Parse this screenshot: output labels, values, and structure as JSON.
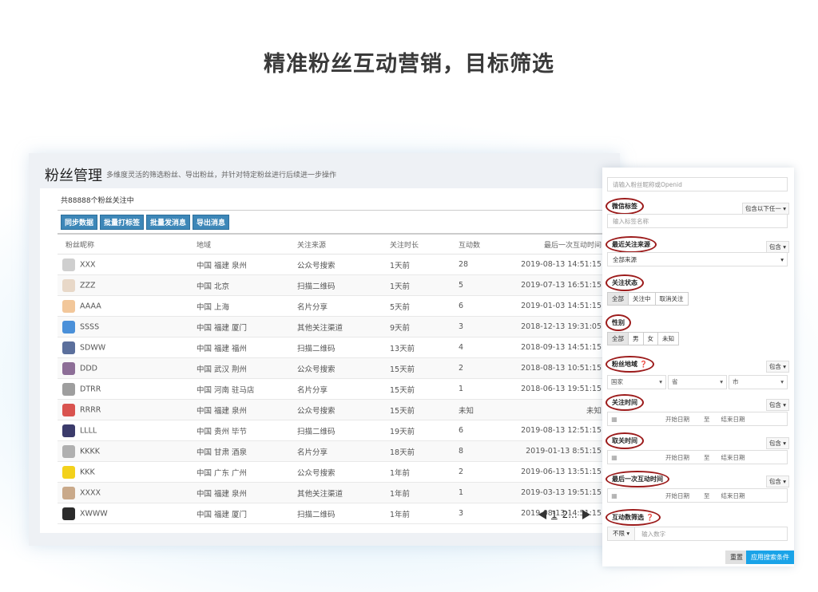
{
  "headline": "精准粉丝互动营销，目标筛选",
  "page": {
    "title": "粉丝管理",
    "subtitle": "多维度灵活的筛选粉丝、导出粉丝，并针对特定粉丝进行后续进一步操作",
    "fan_count": "共88888个粉丝关注中"
  },
  "actions": [
    "同步数据",
    "批量打标签",
    "批量发消息",
    "导出消息"
  ],
  "table": {
    "headers": [
      "粉丝昵称",
      "地域",
      "关注来源",
      "关注时长",
      "互动数",
      "最后一次互动时间"
    ],
    "rows": [
      {
        "name": "XXX",
        "region": "中国 福建 泉州",
        "source": "公众号搜索",
        "duration": "1天前",
        "count": "28",
        "last": "2019-08-13  14:51:15",
        "avatar_color": "#cfcfcf"
      },
      {
        "name": "ZZZ",
        "region": "中国 北京",
        "source": "扫描二维码",
        "duration": "1天前",
        "count": "5",
        "last": "2019-07-13  16:51:15",
        "avatar_color": "#e8d8c8"
      },
      {
        "name": "AAAA",
        "region": "中国 上海",
        "source": "名片分享",
        "duration": "5天前",
        "count": "6",
        "last": "2019-01-03  14:51:15",
        "avatar_color": "#f2c79a"
      },
      {
        "name": "SSSS",
        "region": "中国 福建 厦门",
        "source": "其他关注渠道",
        "duration": "9天前",
        "count": "3",
        "last": "2018-12-13  19:31:05",
        "avatar_color": "#4a90d9"
      },
      {
        "name": "SDWW",
        "region": "中国 福建 福州",
        "source": "扫描二维码",
        "duration": "13天前",
        "count": "4",
        "last": "2018-09-13  14:51:15",
        "avatar_color": "#5b6f9c"
      },
      {
        "name": "DDD",
        "region": "中国 武汉 荆州",
        "source": "公众号搜索",
        "duration": "15天前",
        "count": "2",
        "last": "2018-08-13  10:51:15",
        "avatar_color": "#8d6e97"
      },
      {
        "name": "DTRR",
        "region": "中国 河南 驻马店",
        "source": "名片分享",
        "duration": "15天前",
        "count": "1",
        "last": "2018-06-13  19:51:15",
        "avatar_color": "#9e9e9e"
      },
      {
        "name": "RRRR",
        "region": "中国 福建 泉州",
        "source": "公众号搜索",
        "duration": "15天前",
        "count": "未知",
        "last": "未知",
        "avatar_color": "#d9534f"
      },
      {
        "name": "LLLL",
        "region": "中国 贵州 毕节",
        "source": "扫描二维码",
        "duration": "19天前",
        "count": "6",
        "last": "2019-08-13  12:51:15",
        "avatar_color": "#3b3b6b"
      },
      {
        "name": "KKKK",
        "region": "中国 甘肃 酒泉",
        "source": "名片分享",
        "duration": "18天前",
        "count": "8",
        "last": "2019-01-13  8:51:15",
        "avatar_color": "#b0b0b0"
      },
      {
        "name": "KKK",
        "region": "中国 广东 广州",
        "source": "公众号搜索",
        "duration": "1年前",
        "count": "2",
        "last": "2019-06-13  13:51:15",
        "avatar_color": "#f3d11b"
      },
      {
        "name": "XXXX",
        "region": "中国 福建 泉州",
        "source": "其他关注渠道",
        "duration": "1年前",
        "count": "1",
        "last": "2019-03-13  19:51:15",
        "avatar_color": "#c9a98a"
      },
      {
        "name": "XWWW",
        "region": "中国 福建 厦门",
        "source": "扫描二维码",
        "duration": "1年前",
        "count": "3",
        "last": "2019-08-13  14:51:15",
        "avatar_color": "#2b2b2b"
      }
    ]
  },
  "pager": {
    "page1": "1",
    "page2": "2...",
    "current_page": 1
  },
  "filter": {
    "search_placeholder": "请输入粉丝昵称或Openid",
    "wechat_tag_label": "微信标签",
    "wechat_tag_mode": "包含以下任一 ▾",
    "wechat_tag_placeholder": "输入标签名称",
    "recent_source_label": "最近关注来源",
    "recent_source_mode": "包含 ▾",
    "recent_source_value": "全部来源",
    "follow_status_label": "关注状态",
    "follow_status_options": [
      "全部",
      "关注中",
      "取消关注"
    ],
    "gender_label": "性别",
    "gender_options": [
      "全部",
      "男",
      "女",
      "未知"
    ],
    "region_label": "粉丝地域",
    "region_mode": "包含 ▾",
    "region_country": "国家",
    "region_province": "省",
    "region_city": "市",
    "follow_time_label": "关注时间",
    "follow_time_mode": "包含 ▾",
    "unfollow_time_label": "取关时间",
    "unfollow_time_mode": "包含 ▾",
    "last_interact_label": "最后一次互动时间",
    "last_interact_mode": "包含 ▾",
    "interact_count_label": "互动数筛选",
    "interact_count_select": "不限 ▾",
    "interact_count_placeholder": "输入数字",
    "date_start": "开始日期",
    "date_to": "至",
    "date_end": "结束日期",
    "reset_button": "重置",
    "apply_button": "应用搜索条件"
  }
}
